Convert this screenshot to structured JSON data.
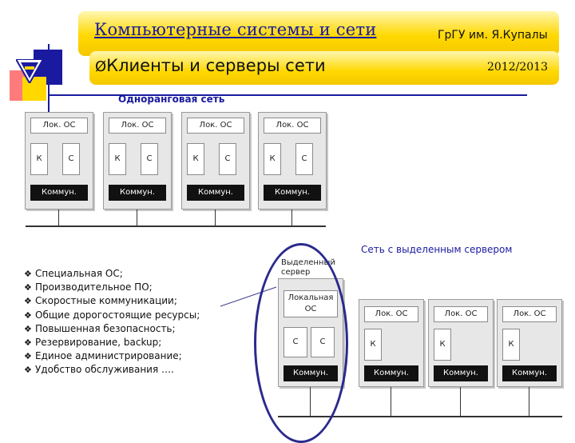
{
  "header": {
    "title": "Компьютерные системы и сети",
    "university": "ГрГУ им. Я.Купалы",
    "subtitle": "Клиенты и серверы сети",
    "subtitle_marker": "Ø",
    "year": "2012/2013"
  },
  "peer": {
    "title": "Одноранговая сеть",
    "computers": [
      {
        "os": "Лок. ОС",
        "k": "К",
        "c": "С",
        "comm": "Коммун."
      },
      {
        "os": "Лок. ОС",
        "k": "К",
        "c": "С",
        "comm": "Коммун."
      },
      {
        "os": "Лок. ОС",
        "k": "К",
        "c": "С",
        "comm": "Коммун."
      },
      {
        "os": "Лок. ОС",
        "k": "К",
        "c": "С",
        "comm": "Коммун."
      }
    ]
  },
  "dedicated": {
    "title": "Сеть с выделенным сервером",
    "server_label_line1": "Выделенный",
    "server_label_line2": "сервер",
    "server": {
      "os_line1": "Локальная",
      "os_line2": "ОС",
      "c1": "С",
      "c2": "С",
      "comm": "Коммун."
    },
    "clients": [
      {
        "os": "Лок. ОС",
        "k": "К",
        "comm": "Коммун."
      },
      {
        "os": "Лок. ОС",
        "k": "К",
        "comm": "Коммун."
      },
      {
        "os": "Лок. ОС",
        "k": "К",
        "comm": "Коммун."
      }
    ]
  },
  "features": {
    "bullet": "❖",
    "items": [
      "Специальная ОС;",
      "Производительное ПО;",
      "Скоростные коммуникации;",
      "Общие дорогостоящие ресурсы;",
      "Повышенная безопасность;",
      "Резервирование, backup;",
      "Единое администрирование;",
      "Удобство обслуживания …."
    ]
  },
  "colors": {
    "title": "#1a1aa0",
    "header_yellow": "#ffd800",
    "section": "#1a1aa0",
    "oval": "#2a2a8c"
  }
}
